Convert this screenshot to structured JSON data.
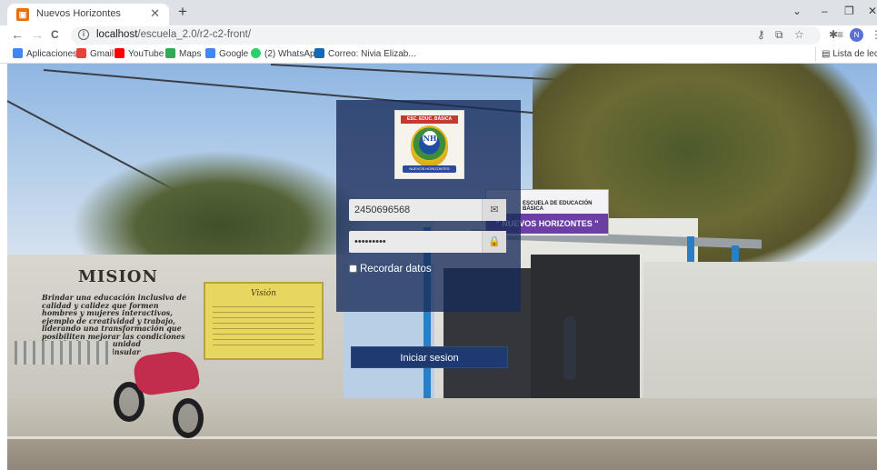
{
  "browser": {
    "tab_title": "Nuevos Horizontes",
    "tab_close": "✕",
    "new_tab": "+",
    "url_host": "localhost",
    "url_path": "/escuela_2.0/r2-c2-front/",
    "avatar_initial": "N",
    "window_controls": {
      "minimize": "–",
      "maximize": "❐",
      "close": "✕"
    },
    "nav": {
      "back": "←",
      "forward": "→",
      "reload": "C"
    }
  },
  "bookmarks": [
    {
      "label": "Aplicaciones",
      "color": "#4285f4"
    },
    {
      "label": "Gmail",
      "color": "#ea4335"
    },
    {
      "label": "YouTube",
      "color": "#ff0000"
    },
    {
      "label": "Maps",
      "color": "#34a853"
    },
    {
      "label": "Google",
      "color": "#4285f4"
    },
    {
      "label": "(2) WhatsApp",
      "color": "#25d366"
    },
    {
      "label": "Correo: Nivia Elizab...",
      "color": "#0f6cbd"
    }
  ],
  "bookmarks_right": "Lista de lectur",
  "scene": {
    "mision_title": "MISION",
    "mision_text": "Brindar una educación inclusiva de calidad y calidez que formen hombres y mujeres interactivos, ejemplo de creatividad y trabajo, liderando una transformación que posibiliten mejorar las condiciones de vida de la comunidad Tumayense y Peninsular",
    "vision_title": "Visión",
    "sign_top": "ESCUELA DE EDUCACIÓN BÁSICA",
    "sign_bottom": "\" NUEVOS HORIZONTES \""
  },
  "login": {
    "logo_banner": "ESC. EDUC. BÁSICA",
    "logo_monogram": "NH",
    "logo_ribbon": "NUEVOS HORIZONTES",
    "user_value": "2450696568",
    "password_value": "•••••••••",
    "user_icon": "✉",
    "password_icon": "🔒",
    "remember_label": "Recordar datos",
    "submit_label": "Iniciar sesion"
  }
}
